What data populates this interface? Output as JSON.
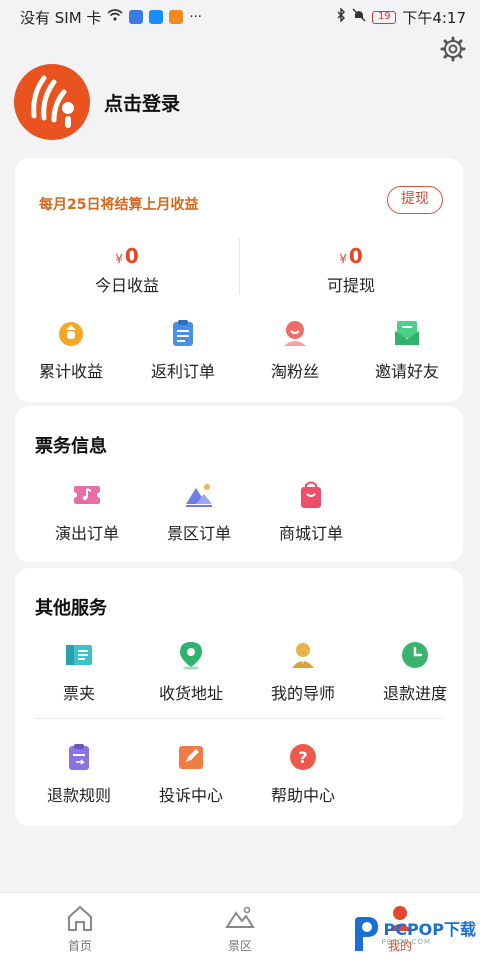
{
  "status_bar": {
    "carrier": "没有 SIM 卡",
    "battery": "19",
    "time": "下午4:17"
  },
  "profile": {
    "login_text": "点击登录"
  },
  "earnings": {
    "settle_notice": "每月25日将结算上月收益",
    "withdraw_label": "提现",
    "currency": "¥",
    "today_amount": "0",
    "today_label": "今日收益",
    "withdrawable_amount": "0",
    "withdrawable_label": "可提现",
    "items": [
      {
        "label": "累计收益",
        "icon": "moneybag-icon"
      },
      {
        "label": "返利订单",
        "icon": "clipboard-icon"
      },
      {
        "label": "淘粉丝",
        "icon": "fan-icon"
      },
      {
        "label": "邀请好友",
        "icon": "invite-icon"
      }
    ]
  },
  "ticket_info": {
    "title": "票务信息",
    "items": [
      {
        "label": "演出订单",
        "icon": "show-ticket-icon"
      },
      {
        "label": "景区订单",
        "icon": "scenic-icon"
      },
      {
        "label": "商城订单",
        "icon": "shopping-bag-icon"
      }
    ]
  },
  "other_services": {
    "title": "其他服务",
    "row1": [
      {
        "label": "票夹",
        "icon": "ticket-folder-icon"
      },
      {
        "label": "收货地址",
        "icon": "location-pin-icon"
      },
      {
        "label": "我的导师",
        "icon": "mentor-icon"
      },
      {
        "label": "退款进度",
        "icon": "clock-icon"
      }
    ],
    "row2": [
      {
        "label": "退款规则",
        "icon": "refund-rules-icon"
      },
      {
        "label": "投诉中心",
        "icon": "complaint-icon"
      },
      {
        "label": "帮助中心",
        "icon": "help-icon"
      }
    ]
  },
  "tab_bar": {
    "tabs": [
      {
        "label": "首页",
        "icon": "home-icon"
      },
      {
        "label": "景区",
        "icon": "mountain-icon"
      },
      {
        "label": "我的",
        "icon": "profile-icon"
      }
    ]
  },
  "watermark": {
    "text": "PCPOP下载",
    "sub": "PCPOP.COM"
  },
  "colors": {
    "accent": "#e2482a",
    "notice": "#d2691e",
    "background": "#f3f3f5"
  }
}
